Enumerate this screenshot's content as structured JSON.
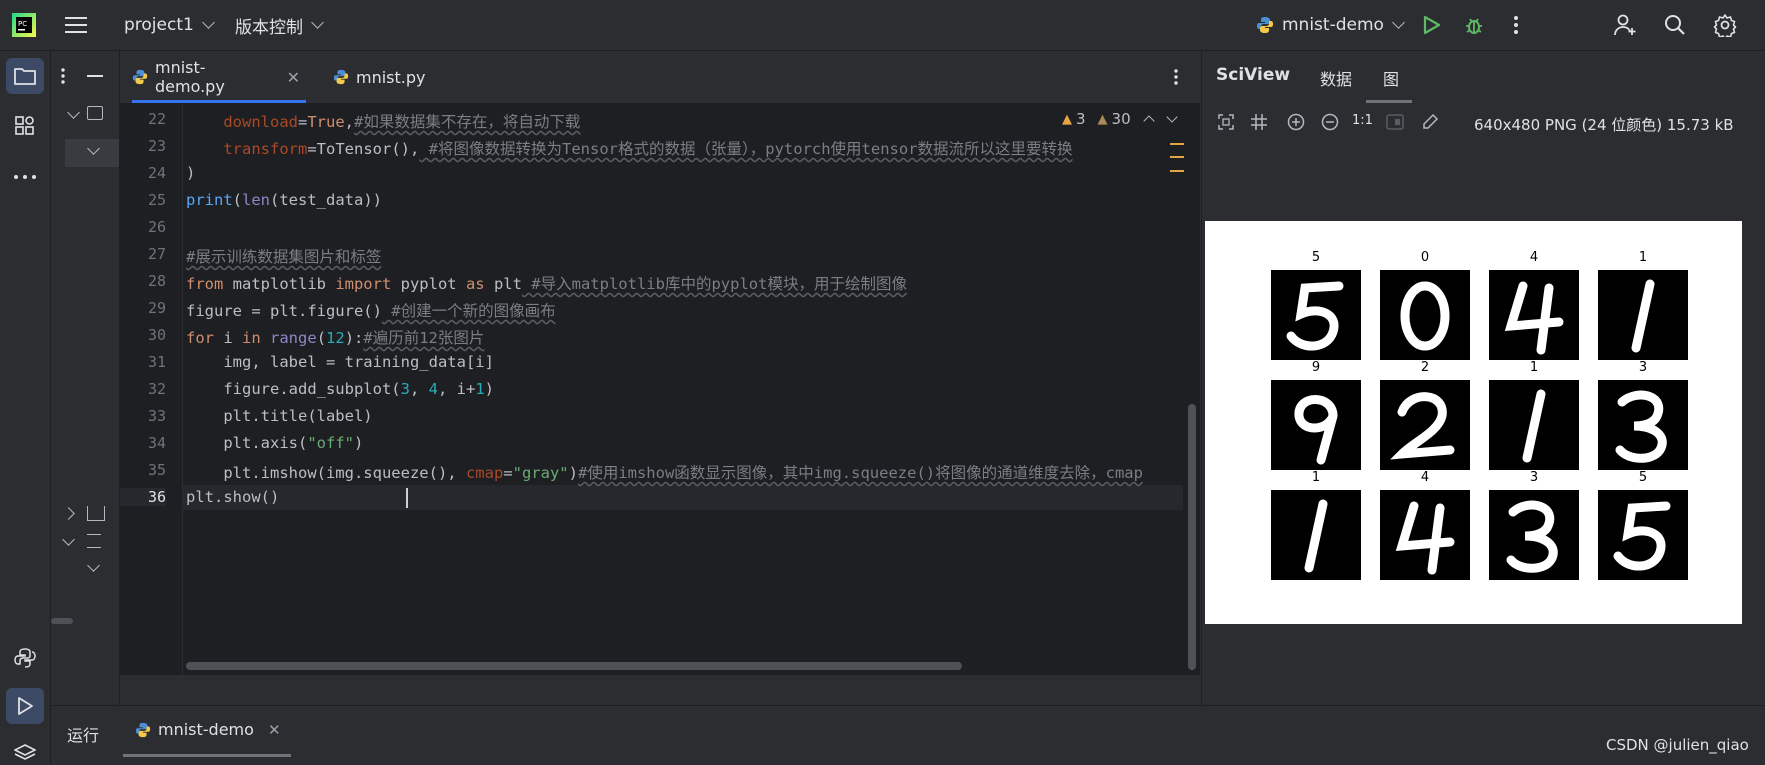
{
  "titlebar": {
    "project": "project1",
    "vcs": "版本控制",
    "run_config": "mnist-demo"
  },
  "tabs": [
    {
      "label": "mnist-demo.py"
    },
    {
      "label": "mnist.py"
    }
  ],
  "inspections": {
    "warnings": "3",
    "weak_warnings": "30"
  },
  "editor": {
    "line_numbers": [
      "22",
      "23",
      "24",
      "25",
      "26",
      "27",
      "28",
      "29",
      "30",
      "31",
      "32",
      "33",
      "34",
      "35",
      "36"
    ],
    "lines": {
      "l22": {
        "param": "download",
        "eq": "=",
        "val": "True",
        "comma": ",",
        "comment": "#如果数据集不存在，将自动下载"
      },
      "l23": {
        "param": "transform",
        "eq": "=",
        "val": "ToTensor(),",
        "comment": " #将图像数据转换为Tensor格式的数据（张量），pytorch使用tensor数据流所以这里要转换"
      },
      "l24": ")",
      "l25": {
        "fn": "print",
        "p1": "(",
        "bi": "len",
        "rest": "(test_data))"
      },
      "l26": "",
      "l27": "#展示训练数据集图片和标签",
      "l28": {
        "kw1": "from",
        "mid1": " matplotlib ",
        "kw2": "import",
        "mid2": " pyplot ",
        "kw3": "as",
        "mid3": " plt",
        "comment": " #导入matplotlib库中的pyplot模块，用于绘制图像"
      },
      "l29": {
        "code": "figure = plt.figure()",
        "comment": " #创建一个新的图像画布"
      },
      "l30": {
        "kw1": "for",
        "mid1": " i ",
        "kw2": "in",
        "sp": " ",
        "bi": "range",
        "p": "(",
        "num": "12",
        "p2": "):",
        "comment": "#遍历前12张图片"
      },
      "l31": "    img, label = training_data[i]",
      "l32": {
        "a": "    figure.add_subplot(",
        "n1": "3",
        "c1": ", ",
        "n2": "4",
        "c2": ", i+",
        "n3": "1",
        "end": ")"
      },
      "l33": "    plt.title(label)",
      "l34": {
        "a": "    plt.axis(",
        "s": "\"off\"",
        "end": ")"
      },
      "l35": {
        "a": "    plt.imshow(img.squeeze(), ",
        "param": "cmap",
        "eq": "=",
        "s": "\"gray\"",
        "end": ")",
        "comment": "#使用imshow函数显示图像，其中img.squeeze()将图像的通道维度去除，cmap"
      },
      "l36": "plt.show()"
    }
  },
  "sciview": {
    "tabs": [
      "SciView",
      "数据",
      "图"
    ],
    "zoom_label": "1:1",
    "image_info": "640x480 PNG (24 位颜色) 15.73 kB",
    "digit_labels": [
      "5",
      "0",
      "4",
      "1",
      "9",
      "2",
      "1",
      "3",
      "1",
      "4",
      "3",
      "5"
    ]
  },
  "bottom": {
    "run_label": "运行",
    "run_tab": "mnist-demo",
    "watermark": "CSDN @julien_qiao"
  },
  "colors": {
    "bg": "#2b2d30",
    "editor_bg": "#1e1f22",
    "accent": "#3574f0",
    "run_green": "#5fb865",
    "warning": "#e5a443"
  },
  "icons": [
    "app-logo-icon",
    "hamburger-menu-icon",
    "python-icon",
    "run-icon",
    "debug-icon",
    "more-vert-icon",
    "add-user-icon",
    "search-icon",
    "settings-icon",
    "folder-icon",
    "structure-icon",
    "more-horiz-icon",
    "python-console-icon",
    "run-tool-icon",
    "layers-icon"
  ]
}
